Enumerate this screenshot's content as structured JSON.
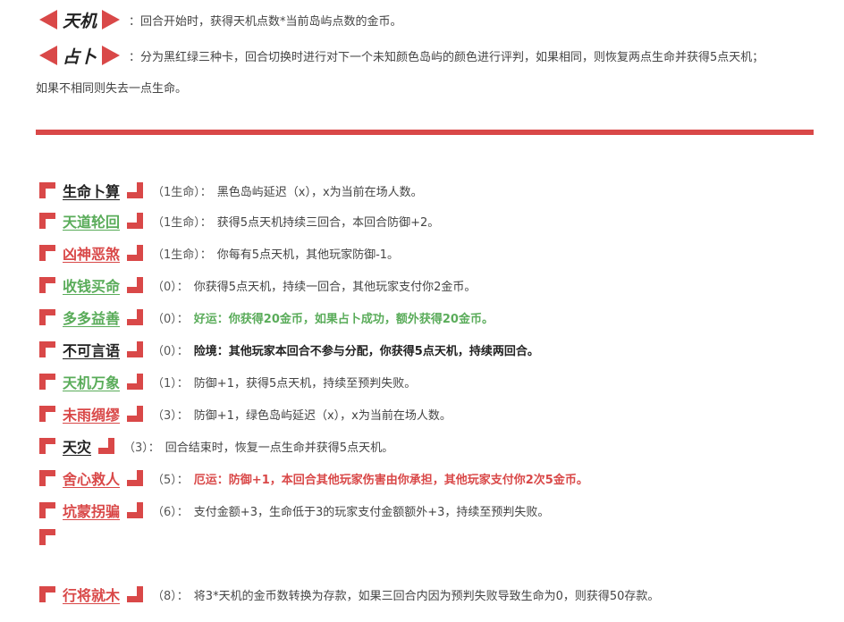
{
  "rules": [
    {
      "tag": "天机",
      "text": "回合开始时，获得天机点数*当前岛屿点数的金币。"
    },
    {
      "tag": "占卜",
      "text": "分为黑红绿三种卡，回合切换时进行对下一个未知颜色岛屿的颜色进行评判，如果相同，则恢复两点生命并获得5点天机；"
    }
  ],
  "rule_continuation": "如果不相同则失去一点生命。",
  "colon": "：",
  "colors": {
    "accent": "#d94848",
    "green": "#5aac5a",
    "dark": "#222222"
  },
  "items": [
    {
      "name": "生命卜算",
      "cost": "（1生命）：",
      "desc": "黑色岛屿延迟（x），x为当前在场人数。"
    },
    {
      "name": "天道轮回",
      "cost": "（1生命）：",
      "desc": "获得5点天机持续三回合，本回合防御+2。"
    },
    {
      "name": "凶神恶煞",
      "cost": "（1生命）：",
      "desc": "你每有5点天机，其他玩家防御-1。"
    },
    {
      "name": "收钱买命",
      "cost": "（0）：",
      "desc": "你获得5点天机，持续一回合，其他玩家支付你2金币。"
    },
    {
      "name": "多多益善",
      "cost": "（0）：",
      "desc": "好运：你获得20金币，如果占卜成功，额外获得20金币。"
    },
    {
      "name": "不可言语",
      "cost": "（0）：",
      "desc": "险境：其他玩家本回合不参与分配，你获得5点天机，持续两回合。"
    },
    {
      "name": "天机万象",
      "cost": "（1）：",
      "desc": "防御+1，获得5点天机，持续至预判失败。"
    },
    {
      "name": "未雨绸缪",
      "cost": "（3）：",
      "desc": "防御+1，绿色岛屿延迟（x），x为当前在场人数。"
    },
    {
      "name": "天灾",
      "cost": "（3）：",
      "desc": "回合结束时，恢复一点生命并获得5点天机。"
    },
    {
      "name": "舍心救人",
      "cost": "（5）：",
      "desc": "厄运：防御+1，本回合其他玩家伤害由你承担，其他玩家支付你2次5金币。"
    },
    {
      "name": "坑蒙拐骗",
      "cost": "（6）：",
      "desc": "支付金额+3，生命低于3的玩家支付金额额外+3，持续至预判失败。"
    },
    {
      "name": "行将就木",
      "cost": "（8）：",
      "desc": "将3*天机的金币数转换为存款，如果三回合内因为预判失败导致生命为0，则获得50存款。"
    }
  ]
}
